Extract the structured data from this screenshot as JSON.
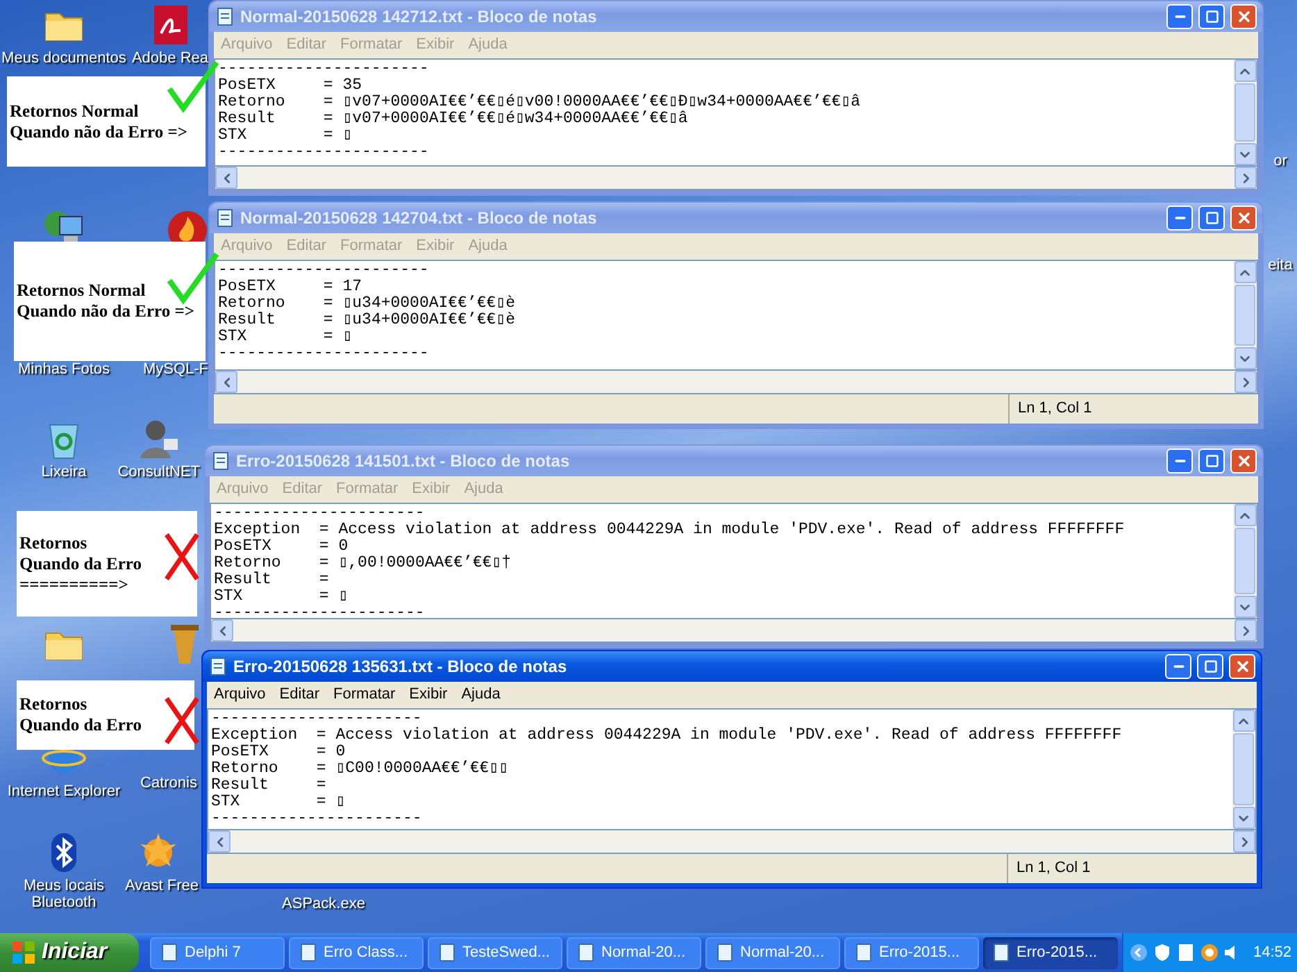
{
  "desktop_icons": [
    {
      "kind": "folder",
      "label": "Meus documentos"
    },
    {
      "kind": "pdf",
      "label": "Adobe Rea"
    },
    {
      "kind": "network"
    },
    {
      "kind": "flame"
    },
    {
      "label": "Minhas Fotos"
    },
    {
      "label": "MySQL-F"
    },
    {
      "kind": "recycle",
      "label": "Lixeira"
    },
    {
      "kind": "user",
      "label": "ConsultNET"
    },
    {
      "kind": "folder"
    },
    {
      "kind": "delphi"
    },
    {
      "kind": "globe",
      "label": "Internet Explorer"
    },
    {
      "label": "Catronis"
    },
    {
      "kind": "bluetooth",
      "label": "Meus locais Bluetooth"
    },
    {
      "kind": "avast",
      "label": "Avast Free"
    },
    {
      "label": "ASPack.exe"
    },
    {
      "label": "or"
    },
    {
      "label": "eita"
    }
  ],
  "annotations": [
    {
      "lines": [
        "Retornos Normal",
        "Quando não da Erro =>"
      ],
      "kind": "check"
    },
    {
      "lines": [
        "Retornos Normal",
        "Quando não da Erro =>"
      ],
      "kind": "check"
    },
    {
      "lines": [
        "Retornos",
        "Quando da Erro",
        "==========>"
      ],
      "kind": "cross"
    },
    {
      "lines": [
        "Retornos",
        "Quando da Erro"
      ],
      "kind": "cross"
    }
  ],
  "windows": [
    {
      "title": "Normal-20150628 142712.txt - Bloco de notas",
      "active": false,
      "menu": [
        "Arquivo",
        "Editar",
        "Formatar",
        "Exibir",
        "Ajuda"
      ],
      "lines": [
        "----------------------",
        "PosETX     = 35",
        "Retorno    = ▯v07+0000AI€€’€€▯é▯v00!0000AA€€’€€▯Ð▯w34+0000AA€€’€€▯â",
        "Result     = ▯v07+0000AI€€’€€▯é▯w34+0000AA€€’€€▯â",
        "STX        = ▯",
        "----------------------"
      ]
    },
    {
      "title": "Normal-20150628 142704.txt - Bloco de notas",
      "active": false,
      "menu": [
        "Arquivo",
        "Editar",
        "Formatar",
        "Exibir",
        "Ajuda"
      ],
      "lines": [
        "----------------------",
        "PosETX     = 17",
        "Retorno    = ▯u34+0000AI€€’€€▯è",
        "Result     = ▯u34+0000AI€€’€€▯è",
        "STX        = ▯",
        "----------------------"
      ],
      "status": "Ln 1, Col 1"
    },
    {
      "title": "Erro-20150628 141501.txt - Bloco de notas",
      "active": false,
      "menu": [
        "Arquivo",
        "Editar",
        "Formatar",
        "Exibir",
        "Ajuda"
      ],
      "lines": [
        "----------------------",
        "Exception  = Access violation at address 0044229A in module 'PDV.exe'. Read of address FFFFFFFF",
        "PosETX     = 0",
        "Retorno    = ▯,00!0000AA€€’€€▯†",
        "Result     =",
        "STX        = ▯",
        "----------------------"
      ]
    },
    {
      "title": "Erro-20150628 135631.txt - Bloco de notas",
      "active": true,
      "menu": [
        "Arquivo",
        "Editar",
        "Formatar",
        "Exibir",
        "Ajuda"
      ],
      "lines": [
        "----------------------",
        "Exception  = Access violation at address 0044229A in module 'PDV.exe'. Read of address FFFFFFFF",
        "PosETX     = 0",
        "Retorno    = ▯C00!0000AA€€’€€▯▯",
        "Result     =",
        "STX        = ▯",
        "----------------------"
      ],
      "status": "Ln 1, Col 1"
    }
  ],
  "taskbar": {
    "start": "Iniciar",
    "items": [
      {
        "label": "Delphi 7",
        "selected": false
      },
      {
        "label": "Erro Class...",
        "selected": false
      },
      {
        "label": "TesteSwed...",
        "selected": false
      },
      {
        "label": "Normal-20...",
        "selected": false
      },
      {
        "label": "Normal-20...",
        "selected": false
      },
      {
        "label": "Erro-2015...",
        "selected": false
      },
      {
        "label": "Erro-2015...",
        "selected": true
      }
    ],
    "clock": "14:52"
  }
}
